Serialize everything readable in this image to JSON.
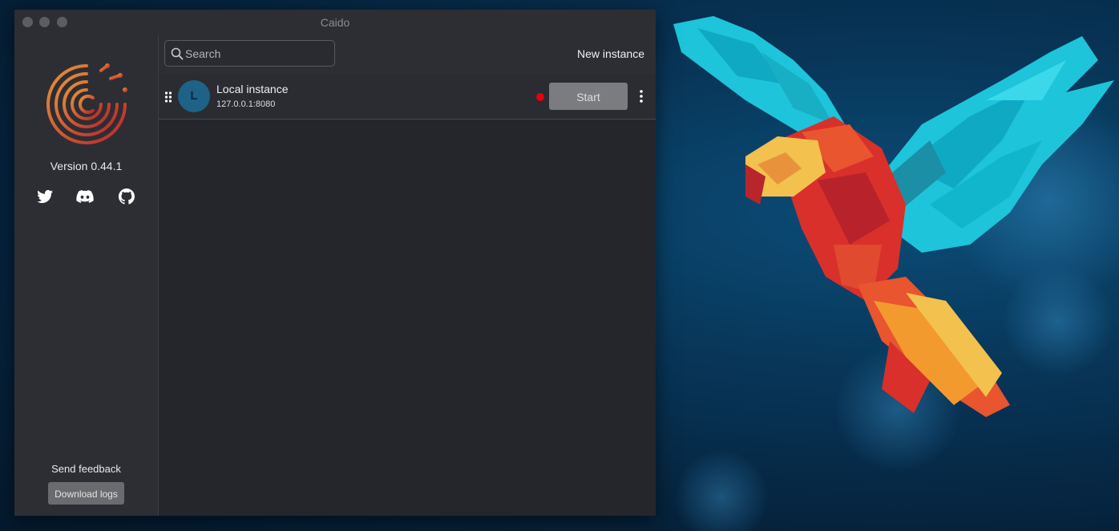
{
  "window": {
    "title": "Caido"
  },
  "sidebar": {
    "version": "Version 0.44.1",
    "social": [
      "twitter-icon",
      "discord-icon",
      "github-icon"
    ],
    "send_feedback": "Send feedback",
    "download_logs": "Download logs"
  },
  "toolbar": {
    "search_placeholder": "Search",
    "new_instance": "New instance"
  },
  "instances": [
    {
      "avatar_letter": "L",
      "name": "Local instance",
      "address": "127.0.0.1:8080",
      "status_color": "#e3000f",
      "action": "Start"
    }
  ],
  "colors": {
    "accent_avatar": "#1e6287",
    "status_stopped": "#e3000f",
    "logo_gradient_start": "#e8933b",
    "logo_gradient_end": "#b8262b"
  }
}
